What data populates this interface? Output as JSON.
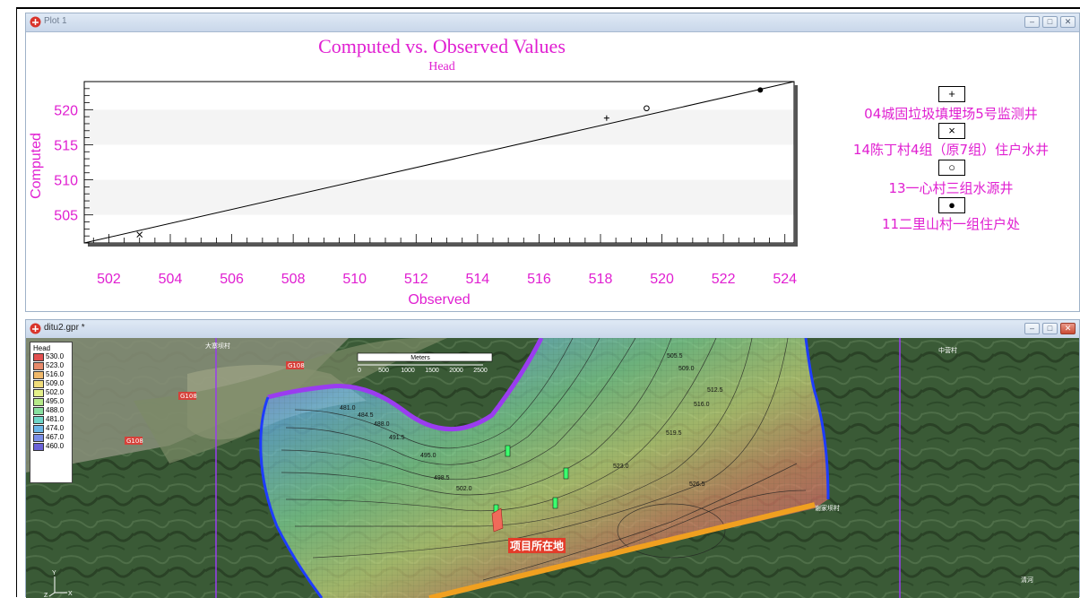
{
  "window1": {
    "title": "Plot 1",
    "buttons": {
      "minimize": "–",
      "maximize": "□",
      "close": "✕"
    }
  },
  "chart_data": {
    "type": "scatter",
    "title": "Computed vs. Observed Values",
    "subtitle": "Head",
    "xlabel": "Observed",
    "ylabel": "Computed",
    "xlim": [
      501.2,
      524.3
    ],
    "ylim": [
      501.0,
      524.0
    ],
    "x_ticks": [
      502,
      504,
      506,
      508,
      510,
      512,
      514,
      516,
      518,
      520,
      522,
      524
    ],
    "y_ticks": [
      505,
      510,
      515,
      520
    ],
    "reference_line": {
      "x": [
        501.2,
        524.3
      ],
      "y": [
        501.0,
        524.0
      ]
    },
    "series": [
      {
        "name": "04城固垃圾填埋场5号监测井",
        "marker": "+",
        "x": [
          518.2
        ],
        "y": [
          518.8
        ]
      },
      {
        "name": "14陈丁村4组（原7组）住户水井",
        "marker": "×",
        "x": [
          503.0
        ],
        "y": [
          502.2
        ]
      },
      {
        "name": "13一心村三组水源井",
        "marker": "○",
        "x": [
          519.5
        ],
        "y": [
          520.2
        ]
      },
      {
        "name": "11二里山村一组住户处",
        "marker": "●",
        "x": [
          523.2
        ],
        "y": [
          522.8
        ]
      }
    ],
    "grid": "alternating horizontal bands",
    "legend_position": "right"
  },
  "legend_markers": [
    "+",
    "×",
    "○",
    "●"
  ],
  "window2": {
    "title": "ditu2.gpr *",
    "buttons": {
      "minimize": "–",
      "maximize": "□",
      "close": "✕"
    }
  },
  "map": {
    "legend_title": "Head",
    "legend_values": [
      "530.0",
      "523.0",
      "516.0",
      "509.0",
      "502.0",
      "495.0",
      "488.0",
      "481.0",
      "474.0",
      "467.0",
      "460.0"
    ],
    "legend_colors": [
      "#e25050",
      "#e88a6a",
      "#f0b86a",
      "#f0dc7a",
      "#e4f08a",
      "#b6ea8a",
      "#88e0a0",
      "#6ed6c8",
      "#6ab6e8",
      "#7a8ee8",
      "#6a62d8"
    ],
    "scale_title": "Meters",
    "scale_ticks": [
      "0",
      "500",
      "1000",
      "1500",
      "2000",
      "2500"
    ],
    "project_label": "项目所在地",
    "contour_labels": [
      "505.5",
      "509.0",
      "512.5",
      "516.0",
      "519.5",
      "523.0",
      "526.5",
      "502.0",
      "498.5",
      "495.0",
      "491.5",
      "488.0",
      "484.5",
      "481.0"
    ],
    "place_labels": [
      "大寨坝村",
      "G108",
      "G108",
      "G108",
      "中营村",
      "谢家坝村",
      "清河"
    ],
    "axis_label_x": "X",
    "axis_label_y": "Y",
    "axis_label_z": "Z"
  }
}
